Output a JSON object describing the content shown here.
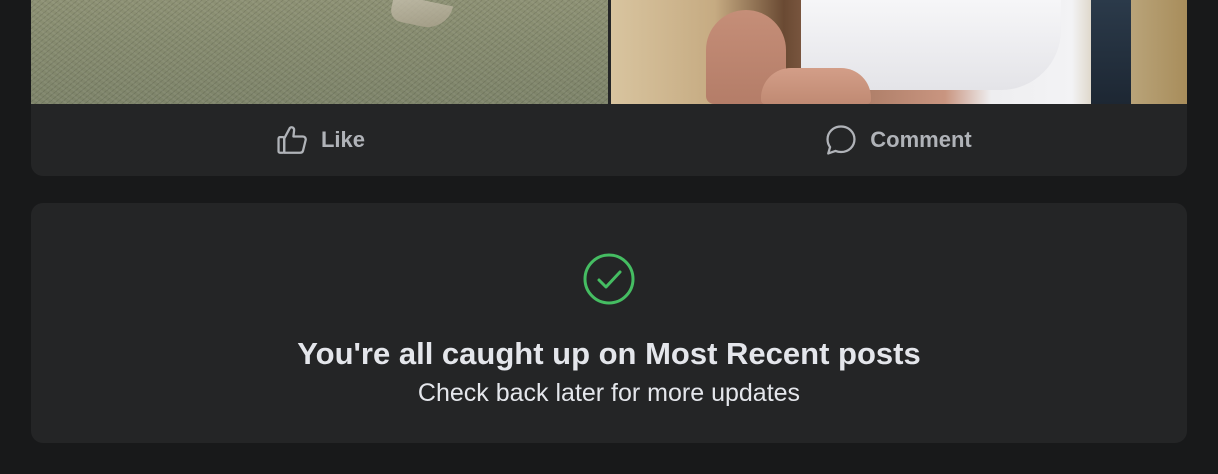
{
  "post": {
    "photos": [
      {
        "description_icon": "photo-grass-bird"
      },
      {
        "description_icon": "photo-person-seated"
      }
    ],
    "actions": {
      "like_label": "Like",
      "like_icon": "thumbs-up-icon",
      "comment_label": "Comment",
      "comment_icon": "comment-bubble-icon"
    }
  },
  "caught_up": {
    "icon": "check-circle-icon",
    "title": "You're all caught up on Most Recent posts",
    "subtitle": "Check back later for more updates"
  },
  "colors": {
    "background": "#18191a",
    "card": "#242526",
    "action_text": "#b0b3b8",
    "primary_text": "#e4e6eb",
    "check_green": "#45bd62"
  }
}
